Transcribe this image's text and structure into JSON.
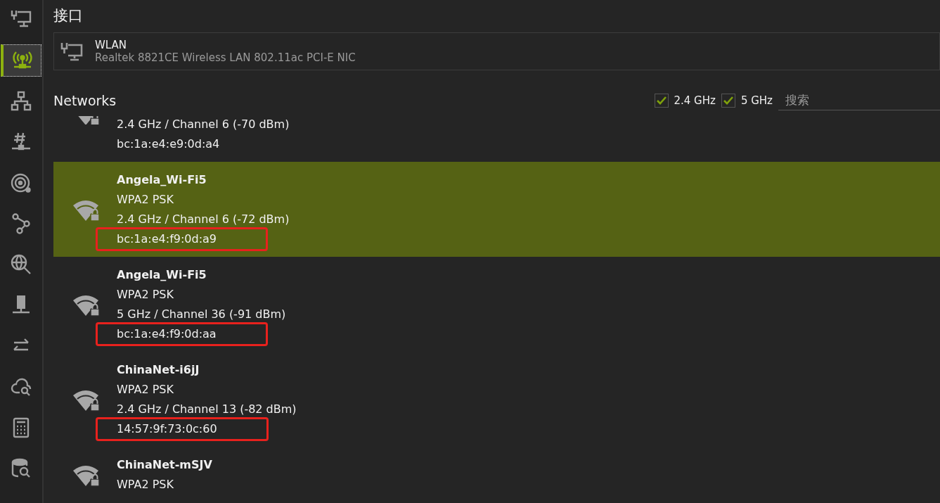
{
  "sidebar": {
    "items": [
      {
        "kind": "wired",
        "selected": false
      },
      {
        "kind": "wireless",
        "selected": true
      },
      {
        "kind": "network",
        "selected": false
      },
      {
        "kind": "hash",
        "selected": false
      },
      {
        "kind": "radar",
        "selected": false
      },
      {
        "kind": "nodes",
        "selected": false
      },
      {
        "kind": "globe",
        "selected": false
      },
      {
        "kind": "server",
        "selected": false
      },
      {
        "kind": "transfer",
        "selected": false
      },
      {
        "kind": "cloud",
        "selected": false
      },
      {
        "kind": "calculator",
        "selected": false
      },
      {
        "kind": "database",
        "selected": false
      }
    ]
  },
  "title": "接口",
  "interface": {
    "name": "WLAN",
    "adapter": "Realtek 8821CE Wireless LAN 802.11ac PCI-E NIC"
  },
  "networks": {
    "heading": "Networks",
    "filters": [
      {
        "label": "2.4 GHz",
        "checked": true
      },
      {
        "label": "5 GHz",
        "checked": true
      }
    ],
    "search": {
      "placeholder": "搜索"
    },
    "rows": [
      {
        "band": "2.4 GHz / Channel 6 (-70 dBm)",
        "mac": "bc:1a:e4:e9:0d:a4",
        "selected": false
      },
      {
        "name": "Angela_Wi-Fi5",
        "security": "WPA2 PSK",
        "band": "2.4 GHz / Channel 6 (-72 dBm)",
        "mac": "bc:1a:e4:f9:0d:a9",
        "selected": true,
        "highlighted": true
      },
      {
        "name": "Angela_Wi-Fi5",
        "security": "WPA2 PSK",
        "band": "5 GHz / Channel 36 (-91 dBm)",
        "mac": "bc:1a:e4:f9:0d:aa",
        "selected": false,
        "highlighted": true
      },
      {
        "name": "ChinaNet-i6jJ",
        "security": "WPA2 PSK",
        "band": "2.4 GHz / Channel 13 (-82 dBm)",
        "mac": "14:57:9f:73:0c:60",
        "selected": false,
        "highlighted": true
      },
      {
        "name": "ChinaNet-mSJV",
        "security": "WPA2 PSK",
        "selected": false
      }
    ]
  }
}
